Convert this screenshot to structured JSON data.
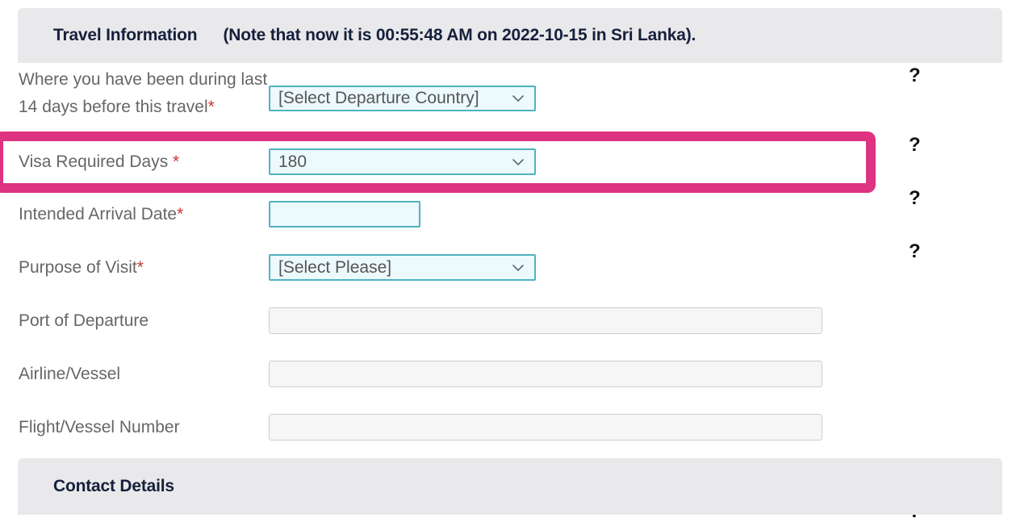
{
  "sections": {
    "travel": {
      "title": "Travel Information",
      "note": "(Note that now it is 00:55:48 AM on 2022-10-15 in Sri Lanka)."
    },
    "contact": {
      "title": "Contact Details"
    }
  },
  "fields": [
    {
      "label": "Where you have been during last 14 days before this travel",
      "required": true,
      "required_mark": "*",
      "control": "select",
      "value": "[Select Departure Country]",
      "disabled": false
    },
    {
      "label": "Visa Required Days ",
      "required": true,
      "required_mark": "*",
      "control": "select",
      "value": "180",
      "disabled": false
    },
    {
      "label": "Intended Arrival Date",
      "required": true,
      "required_mark": "*",
      "control": "input",
      "value": "",
      "disabled": false
    },
    {
      "label": "Purpose of Visit",
      "required": true,
      "required_mark": "*",
      "control": "select",
      "value": "[Select Please]",
      "disabled": false
    },
    {
      "label": "Port of Departure",
      "required": false,
      "required_mark": "",
      "control": "input",
      "value": "",
      "disabled": true
    },
    {
      "label": "Airline/Vessel",
      "required": false,
      "required_mark": "",
      "control": "input",
      "value": "",
      "disabled": true
    },
    {
      "label": "Flight/Vessel Number",
      "required": false,
      "required_mark": "",
      "control": "input",
      "value": "",
      "disabled": true
    }
  ],
  "help_icons": [
    {
      "glyph": "?"
    },
    {
      "glyph": "?"
    },
    {
      "glyph": "?"
    },
    {
      "glyph": "?"
    },
    {
      "glyph": "?"
    }
  ],
  "highlight": {
    "target_field": "Visa Required Days",
    "color": "#dd3380"
  },
  "colors": {
    "section_bar": "#e9e9eb",
    "section_title": "#16203c",
    "label": "#666666",
    "required_asterisk": "#cc3333",
    "control_border": "#4fb3bf",
    "control_fill": "#edfafd",
    "disabled_fill": "#f6f6f6",
    "disabled_border": "#cfcfcf",
    "highlight_pink": "#dd3380"
  }
}
